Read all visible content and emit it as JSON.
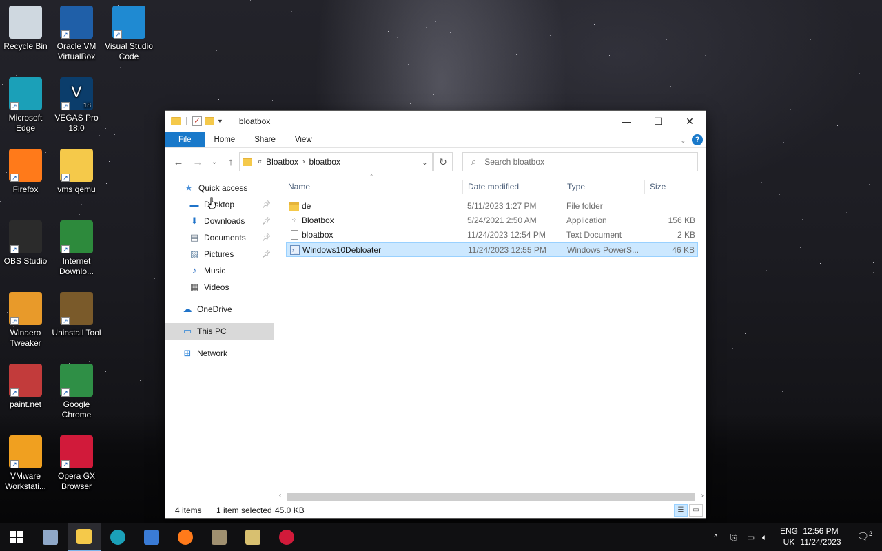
{
  "desktop": {
    "icons": [
      {
        "label": "Recycle Bin",
        "icon": "recycle-bin-icon",
        "color": "#cfd8e0"
      },
      {
        "label": "Oracle VM VirtualBox",
        "icon": "virtualbox-icon",
        "color": "#1f5fa8"
      },
      {
        "label": "Visual Studio Code",
        "icon": "vscode-icon",
        "color": "#1f8ad2"
      },
      {
        "label": "Microsoft Edge",
        "icon": "edge-icon",
        "color": "#1ba0b8"
      },
      {
        "label": "VEGAS Pro 18.0",
        "icon": "vegas-icon",
        "color": "#0b3d6b",
        "badge": "V",
        "sub": "18"
      },
      {
        "label": "Firefox",
        "icon": "firefox-icon",
        "color": "#ff7a1a"
      },
      {
        "label": "vms qemu",
        "icon": "folder-icon",
        "color": "#f5c94a"
      },
      {
        "label": "OBS Studio",
        "icon": "obs-icon",
        "color": "#2b2b2b"
      },
      {
        "label": "Internet Downlo...",
        "icon": "idm-icon",
        "color": "#2d8a3c"
      },
      {
        "label": "Winaero Tweaker",
        "icon": "winaero-icon",
        "color": "#e89a2a"
      },
      {
        "label": "Uninstall Tool",
        "icon": "uninstall-tool-icon",
        "color": "#7a5a2a"
      },
      {
        "label": "paint.net",
        "icon": "paintnet-icon",
        "color": "#c23b3b"
      },
      {
        "label": "Google Chrome",
        "icon": "chrome-icon",
        "color": "#2f8f46"
      },
      {
        "label": "VMware Workstati...",
        "icon": "vmware-icon",
        "color": "#f0a020"
      },
      {
        "label": "Opera GX Browser",
        "icon": "opera-gx-icon",
        "color": "#d11a3a"
      }
    ]
  },
  "window": {
    "title": "bloatbox",
    "ribbon_tabs": [
      "File",
      "Home",
      "Share",
      "View"
    ],
    "help": "?",
    "address": {
      "sep": "«",
      "crumbs": [
        "Bloatbox",
        "bloatbox"
      ]
    },
    "search_placeholder": "Search bloatbox",
    "nav": [
      {
        "label": "Quick access",
        "icon": "star-icon",
        "pinned": false
      },
      {
        "label": "Desktop",
        "icon": "desktop-icon",
        "pinned": true
      },
      {
        "label": "Downloads",
        "icon": "download-arrow-icon",
        "pinned": true
      },
      {
        "label": "Documents",
        "icon": "documents-icon",
        "pinned": true
      },
      {
        "label": "Pictures",
        "icon": "pictures-icon",
        "pinned": true
      },
      {
        "label": "Music",
        "icon": "music-note-icon",
        "pinned": false
      },
      {
        "label": "Videos",
        "icon": "videos-icon",
        "pinned": false
      },
      {
        "label": "OneDrive",
        "icon": "cloud-icon",
        "pinned": false
      },
      {
        "label": "This PC",
        "icon": "monitor-icon",
        "pinned": false
      },
      {
        "label": "Network",
        "icon": "network-icon",
        "pinned": false
      }
    ],
    "columns": [
      "Name",
      "Date modified",
      "Type",
      "Size"
    ],
    "files": [
      {
        "name": "de",
        "date": "5/11/2023 1:27 PM",
        "type": "File folder",
        "size": "",
        "icon": "folder-icon"
      },
      {
        "name": "Bloatbox",
        "date": "5/24/2021 2:50 AM",
        "type": "Application",
        "size": "156 KB",
        "icon": "application-icon"
      },
      {
        "name": "bloatbox",
        "date": "11/24/2023 12:54 PM",
        "type": "Text Document",
        "size": "2 KB",
        "icon": "text-document-icon"
      },
      {
        "name": "Windows10Debloater",
        "date": "11/24/2023 12:55 PM",
        "type": "Windows PowerS...",
        "size": "46 KB",
        "icon": "powershell-script-icon",
        "selected": true
      }
    ],
    "status": {
      "count": "4 items",
      "selected": "1 item selected",
      "size": "45.0 KB"
    }
  },
  "taskbar": {
    "apps": [
      {
        "icon": "start-windows-icon",
        "color": "#ffffff"
      },
      {
        "icon": "paintnet-taskbar-icon",
        "color": "#8fa8c8"
      },
      {
        "icon": "file-explorer-icon",
        "color": "#f5c94a",
        "active": true
      },
      {
        "icon": "edge-taskbar-icon",
        "color": "#1ba0b8"
      },
      {
        "icon": "store-icon",
        "color": "#3a7bd5"
      },
      {
        "icon": "firefox-taskbar-icon",
        "color": "#ff7a1a"
      },
      {
        "icon": "uninstall-tool-taskbar-icon",
        "color": "#a09070"
      },
      {
        "icon": "winaero-taskbar-icon",
        "color": "#d8c070"
      },
      {
        "icon": "opera-gx-taskbar-icon",
        "color": "#d11a3a"
      }
    ],
    "lang_top": "ENG",
    "lang_bottom": "UK",
    "time": "12:56 PM",
    "date": "11/24/2023",
    "notifications": "2"
  }
}
